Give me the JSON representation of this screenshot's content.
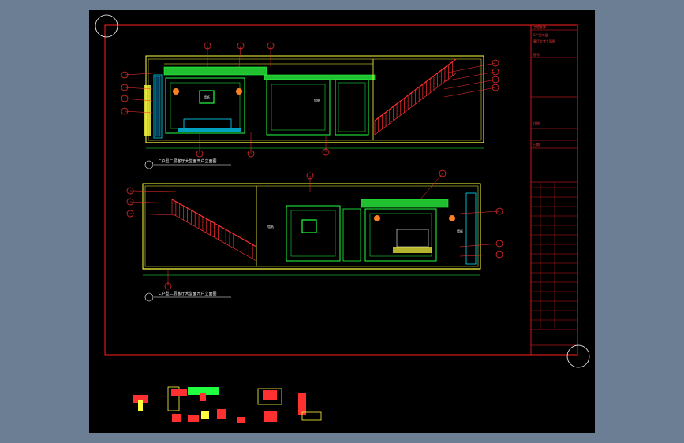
{
  "window": {
    "background": "#6b7e94",
    "canvas_background": "#000000"
  },
  "drawing": {
    "elevation_top": {
      "caption": "C户型二层客厅大堂面开户立面图",
      "room_labels": [
        "墙纸",
        "墙纸"
      ]
    },
    "elevation_bottom": {
      "caption": "C户型二层客厅大堂面开户立面图",
      "room_labels": [
        "墙纸",
        "墙纸"
      ]
    },
    "title_block": {
      "rows": [
        "工程名称",
        "C户型二层",
        "客厅大堂立面图",
        "图号",
        "比例",
        "日期"
      ]
    },
    "colors": {
      "frame": "#ff2020",
      "wall": "#ffff40",
      "panel": "#20ff40",
      "accent": "#00e0ff",
      "white": "#ffffff",
      "magenta": "#ff40ff"
    }
  },
  "icons": [
    "crosshair-circle-icon",
    "crosshair-circle-icon"
  ]
}
